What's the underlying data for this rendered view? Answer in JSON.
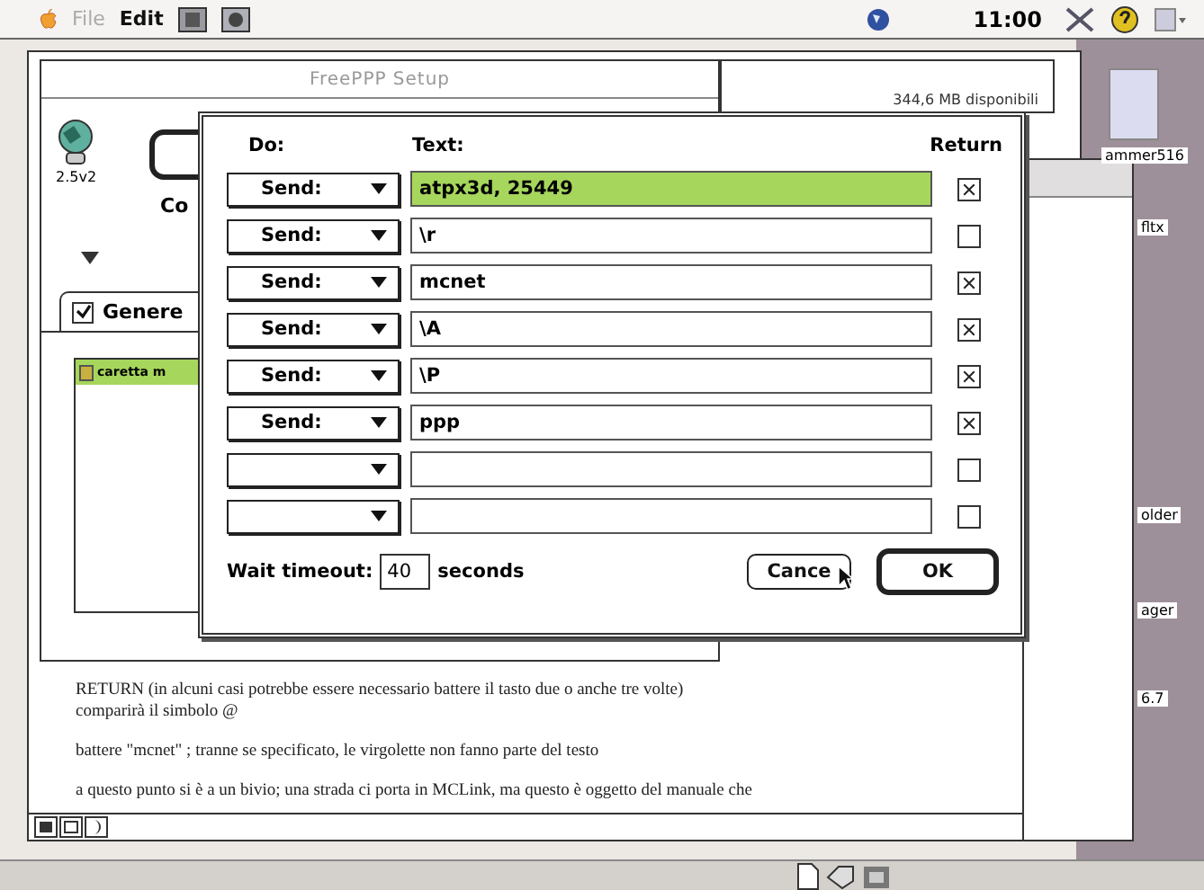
{
  "menu_bar": {
    "items": [
      {
        "label": "File",
        "disabled": true
      },
      {
        "label": "Edit",
        "disabled": false
      }
    ],
    "time": "11:00"
  },
  "setup_window": {
    "title": "FreePPP Setup",
    "version": "2.5v2",
    "label": "Co",
    "tab": {
      "label": "Genere",
      "checked": true
    },
    "list_items": [
      {
        "label": "caretta m",
        "selected": true
      }
    ]
  },
  "disk_window": {
    "free_space": "344,6 MB disponibili"
  },
  "desktop_icons": [
    "ammer516",
    "fltx",
    "older",
    "ager",
    "6.7"
  ],
  "dialog": {
    "headers": {
      "do": "Do:",
      "text": "Text:",
      "return": "Return"
    },
    "rows": [
      {
        "action": "Send:",
        "text": "atpx3d, 25449",
        "selected": true,
        "return": true
      },
      {
        "action": "Send:",
        "text": "\\r",
        "selected": false,
        "return": false
      },
      {
        "action": "Send:",
        "text": "mcnet",
        "selected": false,
        "return": true
      },
      {
        "action": "Send:",
        "text": "\\A",
        "selected": false,
        "return": true
      },
      {
        "action": "Send:",
        "text": "\\P",
        "selected": false,
        "return": true
      },
      {
        "action": "Send:",
        "text": "ppp",
        "selected": false,
        "return": true
      },
      {
        "selected": false,
        "return": false
      },
      {
        "selected": false,
        "return": false
      }
    ],
    "timeout_label": "Wait timeout:",
    "timeout_value": "40",
    "timeout_unit": "seconds",
    "buttons": [
      {
        "label": "Cance",
        "default": false
      },
      {
        "label": "OK",
        "default": true
      }
    ]
  },
  "document": {
    "paragraphs": [
      [
        "RETURN (in alcuni casi potrebbe essere necessario battere il tasto due o anche tre volte)",
        "comparirà il simbolo @"
      ],
      [
        "battere \"mcnet\" ; tranne se specificato, le virgolette non fanno parte del testo"
      ],
      [
        "a questo punto si è a un bivio; una strada ci porta in MCLink, ma questo è oggetto del manuale che"
      ]
    ]
  }
}
